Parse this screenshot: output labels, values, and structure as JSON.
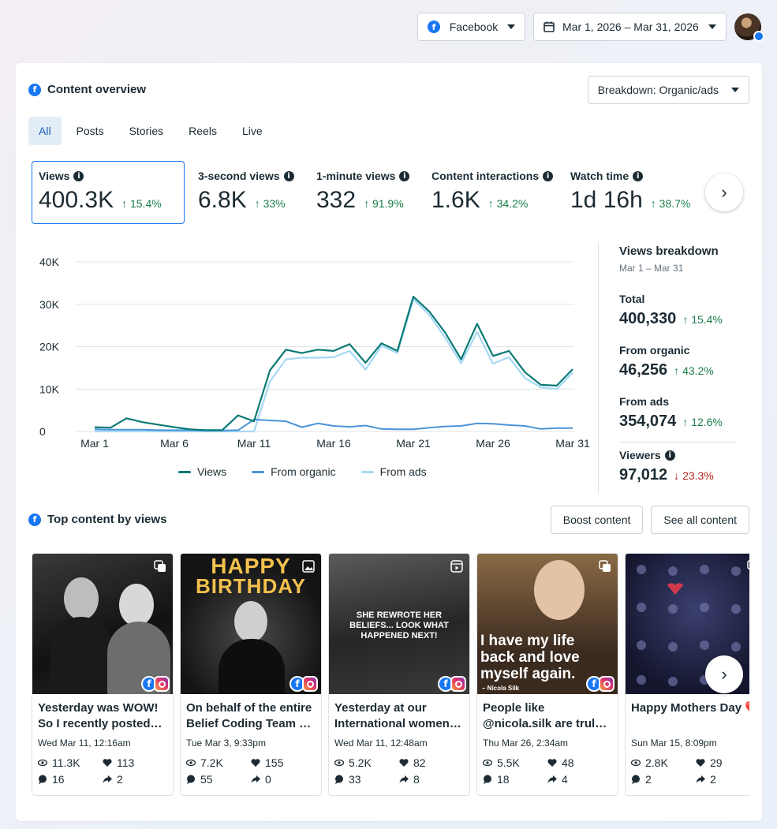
{
  "topbar": {
    "platform": "Facebook",
    "date_range": "Mar 1, 2026 – Mar 31, 2026"
  },
  "overview": {
    "title": "Content overview",
    "breakdown": "Breakdown: Organic/ads",
    "tabs": [
      "All",
      "Posts",
      "Stories",
      "Reels",
      "Live"
    ],
    "metrics": [
      {
        "label": "Views",
        "value": "400.3K",
        "change": "15.4%"
      },
      {
        "label": "3-second views",
        "value": "6.8K",
        "change": "33%"
      },
      {
        "label": "1-minute views",
        "value": "332",
        "change": "91.9%"
      },
      {
        "label": "Content interactions",
        "value": "1.6K",
        "change": "34.2%"
      },
      {
        "label": "Watch time",
        "value": "1d 16h",
        "change": "38.7%"
      }
    ]
  },
  "chart_data": {
    "type": "line",
    "x": [
      "Mar 1",
      "Mar 2",
      "Mar 3",
      "Mar 4",
      "Mar 5",
      "Mar 6",
      "Mar 7",
      "Mar 8",
      "Mar 9",
      "Mar 10",
      "Mar 11",
      "Mar 12",
      "Mar 13",
      "Mar 14",
      "Mar 15",
      "Mar 16",
      "Mar 17",
      "Mar 18",
      "Mar 19",
      "Mar 20",
      "Mar 21",
      "Mar 22",
      "Mar 23",
      "Mar 24",
      "Mar 25",
      "Mar 26",
      "Mar 27",
      "Mar 28",
      "Mar 29",
      "Mar 30",
      "Mar 31"
    ],
    "x_ticks": [
      "Mar 1",
      "Mar 6",
      "Mar 11",
      "Mar 16",
      "Mar 21",
      "Mar 26",
      "Mar 31"
    ],
    "y_ticks": [
      "0",
      "10K",
      "20K",
      "30K",
      "40K"
    ],
    "ylim": [
      0,
      40000
    ],
    "grid": true,
    "legend_position": "bottom",
    "series": [
      {
        "name": "Views",
        "color": "#0b7a75",
        "values": [
          1000,
          900,
          3100,
          2200,
          1600,
          1000,
          500,
          300,
          300,
          3800,
          2400,
          14400,
          19300,
          18500,
          19300,
          19000,
          20600,
          16200,
          20800,
          19000,
          31800,
          28300,
          23300,
          17000,
          25400,
          17800,
          19000,
          14000,
          11000,
          10800,
          14700
        ]
      },
      {
        "name": "From organic",
        "color": "#4a94d9",
        "values": [
          500,
          400,
          400,
          400,
          300,
          300,
          300,
          200,
          200,
          300,
          2800,
          2600,
          2400,
          1000,
          1900,
          1300,
          1100,
          1400,
          600,
          500,
          500,
          900,
          1200,
          1300,
          1900,
          1800,
          1500,
          1300,
          600,
          800,
          800
        ]
      },
      {
        "name": "From ads",
        "color": "#a6d8f5",
        "values": [
          0,
          0,
          0,
          0,
          0,
          0,
          0,
          0,
          0,
          0,
          0,
          11800,
          17000,
          17400,
          17400,
          17500,
          19000,
          14600,
          20200,
          18500,
          31200,
          27500,
          22100,
          16100,
          23500,
          16000,
          17500,
          12600,
          10400,
          10000,
          13900
        ]
      }
    ]
  },
  "views_breakdown": {
    "title": "Views breakdown",
    "period": "Mar 1 – Mar 31",
    "rows": [
      {
        "label": "Total",
        "value": "400,330",
        "change": "15.4%",
        "dir": "up"
      },
      {
        "label": "From organic",
        "value": "46,256",
        "change": "43.2%",
        "dir": "up"
      },
      {
        "label": "From ads",
        "value": "354,074",
        "change": "12.6%",
        "dir": "up"
      }
    ],
    "viewers": {
      "label": "Viewers",
      "value": "97,012",
      "change": "23.3%",
      "dir": "down"
    }
  },
  "top_content": {
    "title": "Top content by views",
    "boost_label": "Boost content",
    "see_all_label": "See all content",
    "posts": [
      {
        "text": "Yesterday was WOW! So I recently posted about",
        "date": "Wed Mar 11, 12:16am",
        "views": "11.3K",
        "likes": "113",
        "comments": "16",
        "shares": "2",
        "type": "carousel",
        "overlay": []
      },
      {
        "text": "On behalf of the entire Belief Coding Team & our",
        "date": "Tue Mar 3, 9:33pm",
        "views": "7.2K",
        "likes": "155",
        "comments": "55",
        "shares": "0",
        "type": "photo",
        "overlay": [
          "HAPPY",
          "BIRTHDAY"
        ]
      },
      {
        "text": "Yesterday at our International women's day",
        "date": "Wed Mar 11, 12:48am",
        "views": "5.2K",
        "likes": "82",
        "comments": "33",
        "shares": "8",
        "type": "reel",
        "overlay": [
          "SHE REWROTE HER",
          "BELIEFS... LOOK WHAT",
          "HAPPENED NEXT!"
        ]
      },
      {
        "text": "People like @nicola.silk are truly why we love what",
        "date": "Thu Mar 26, 2:34am",
        "views": "5.5K",
        "likes": "48",
        "comments": "18",
        "shares": "4",
        "type": "carousel",
        "overlay": [
          "I have my life",
          "back and love",
          "myself again.",
          "– Nicola Silk"
        ]
      },
      {
        "text": "Happy Mothers Day ❤️",
        "date": "Sun Mar 15, 8:09pm",
        "views": "2.8K",
        "likes": "29",
        "comments": "2",
        "shares": "2",
        "type": "carousel",
        "overlay": []
      }
    ]
  }
}
